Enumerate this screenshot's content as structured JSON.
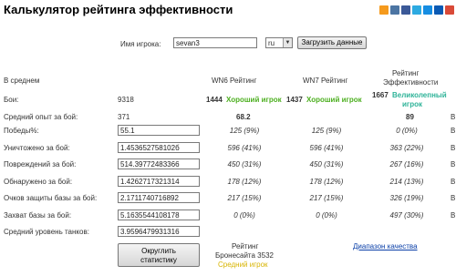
{
  "header": {
    "title": "Калькулятор рейтинга эффективности",
    "social_icons": [
      {
        "name": "odnoklassniki-icon",
        "color": "#f59a1d"
      },
      {
        "name": "vkontakte-icon",
        "color": "#4c75a3"
      },
      {
        "name": "facebook-icon",
        "color": "#3b5998"
      },
      {
        "name": "twitter-icon",
        "color": "#2daae1"
      },
      {
        "name": "mailru-icon",
        "color": "#168de2"
      },
      {
        "name": "livejournal-icon",
        "color": "#0a5ab4"
      },
      {
        "name": "google-icon",
        "color": "#d94a38"
      }
    ]
  },
  "form": {
    "player_label": "Имя игрока:",
    "player_value": "sevan3",
    "server_value": "ru",
    "load_button": "Загрузить данные"
  },
  "columns": {
    "avg": "В среднем",
    "wn6": "WN6 Рейтинг",
    "wn7": "WN7 Рейтинг",
    "eff_line1": "Рейтинг",
    "eff_line2": "Эффективности"
  },
  "battles": {
    "label": "Бои:",
    "value": "9318",
    "wn6_value": "1444",
    "wn6_grade": "Хороший игрок",
    "wn7_value": "1437",
    "wn7_grade": "Хороший игрок",
    "eff_value": "1667",
    "eff_grade_line1": "Великолепный",
    "eff_grade_line2": "игрок"
  },
  "avg_exp": {
    "label": "Средний опыт за бой:",
    "value": "371",
    "wn6": "68.2",
    "eff": "89",
    "cut": "В"
  },
  "rows": [
    {
      "label": "Победы%:",
      "value": "55.1",
      "wn6": "125 (9%)",
      "wn7": "125 (9%)",
      "eff": "0 (0%)",
      "cut": "В"
    },
    {
      "label": "Уничтожено за бой:",
      "value": "1.453652758102б",
      "wn6": "596 (41%)",
      "wn7": "596 (41%)",
      "eff": "363 (22%)",
      "cut": "В"
    },
    {
      "label": "Повреждений за бой:",
      "value": "514.39772483366",
      "wn6": "450 (31%)",
      "wn7": "450 (31%)",
      "eff": "267 (16%)",
      "cut": "В"
    },
    {
      "label": "Обнаружено за бой:",
      "value": "1.4262717321314",
      "wn6": "178 (12%)",
      "wn7": "178 (12%)",
      "eff": "214 (13%)",
      "cut": "В"
    },
    {
      "label": "Очков защиты базы за бой:",
      "value": "2.1711740716892",
      "wn6": "217 (15%)",
      "wn7": "217 (15%)",
      "eff": "326 (19%)",
      "cut": "В"
    },
    {
      "label": "Захват базы за бой:",
      "value": "5.1635544108178",
      "wn6": "0 (0%)",
      "wn7": "0 (0%)",
      "eff": "497 (30%)",
      "cut": "В"
    },
    {
      "label": "Средний уровень танков:",
      "value": "3.9596479931316",
      "wn6": "",
      "wn7": "",
      "eff": "",
      "cut": ""
    }
  ],
  "footer": {
    "round_button_line1": "Округлить",
    "round_button_line2": "статистику",
    "armor_line1": "Рейтинг",
    "armor_line2": "Бронесайта 3532",
    "armor_grade": "Средний игрок",
    "range_link": "Диапазон качества"
  }
}
